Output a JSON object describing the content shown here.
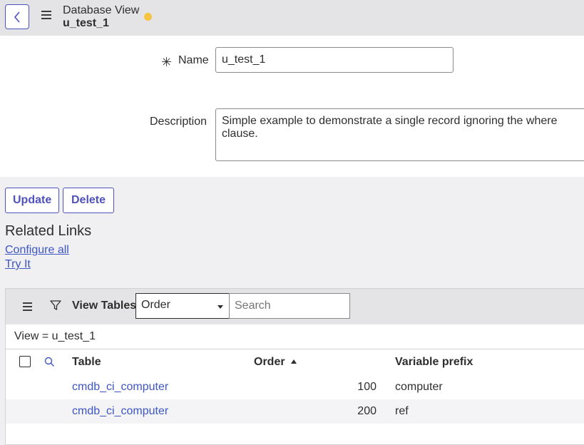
{
  "header": {
    "title": "Database View",
    "record": "u_test_1"
  },
  "form": {
    "name_label": "Name",
    "name_value": "u_test_1",
    "description_label": "Description",
    "description_value": "Simple example to demonstrate a single record ignoring the where clause."
  },
  "actions": {
    "update": "Update",
    "delete": "Delete"
  },
  "related_links": {
    "title": "Related Links",
    "configure_all": "Configure all",
    "try_it": "Try It"
  },
  "related_list": {
    "title": "View Tables",
    "select_value": "Order",
    "search_placeholder": "Search",
    "breadcrumb": "View = u_test_1",
    "columns": {
      "table": "Table",
      "order": "Order",
      "variable_prefix": "Variable prefix"
    },
    "rows": [
      {
        "table": "cmdb_ci_computer",
        "order": "100",
        "prefix": "computer"
      },
      {
        "table": "cmdb_ci_computer",
        "order": "200",
        "prefix": "ref"
      }
    ]
  },
  "colors": {
    "accent": "#4f52bd",
    "link": "#3d56c4",
    "unsaved_dot": "#f7c343"
  }
}
